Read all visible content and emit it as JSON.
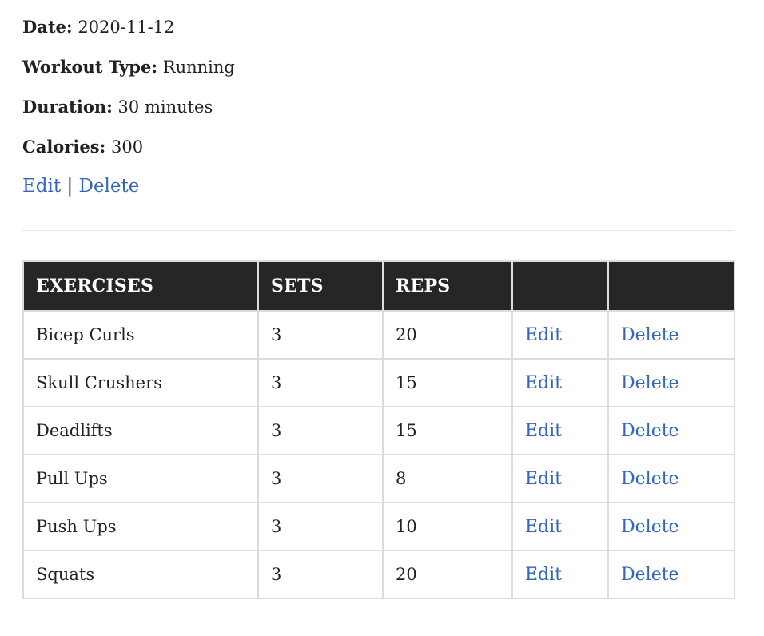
{
  "workout": {
    "date_label": "Date:",
    "date_value": "2020-11-12",
    "type_label": "Workout Type:",
    "type_value": "Running",
    "duration_label": "Duration:",
    "duration_value": "30 minutes",
    "calories_label": "Calories:",
    "calories_value": "300",
    "edit_label": "Edit",
    "separator": "|",
    "delete_label": "Delete"
  },
  "table": {
    "headers": [
      "EXERCISES",
      "SETS",
      "REPS",
      "",
      ""
    ],
    "rows": [
      {
        "exercise": "Bicep Curls",
        "sets": "3",
        "reps": "20",
        "edit": "Edit",
        "delete": "Delete"
      },
      {
        "exercise": "Skull Crushers",
        "sets": "3",
        "reps": "15",
        "edit": "Edit",
        "delete": "Delete"
      },
      {
        "exercise": "Deadlifts",
        "sets": "3",
        "reps": "15",
        "edit": "Edit",
        "delete": "Delete"
      },
      {
        "exercise": "Pull Ups",
        "sets": "3",
        "reps": "8",
        "edit": "Edit",
        "delete": "Delete"
      },
      {
        "exercise": "Push Ups",
        "sets": "3",
        "reps": "10",
        "edit": "Edit",
        "delete": "Delete"
      },
      {
        "exercise": "Squats",
        "sets": "3",
        "reps": "20",
        "edit": "Edit",
        "delete": "Delete"
      }
    ]
  },
  "colors": {
    "link": "#3366bb",
    "header_bg": "#262626",
    "header_text": "#ffffff",
    "border": "#dcdcdc",
    "text": "#222222"
  }
}
